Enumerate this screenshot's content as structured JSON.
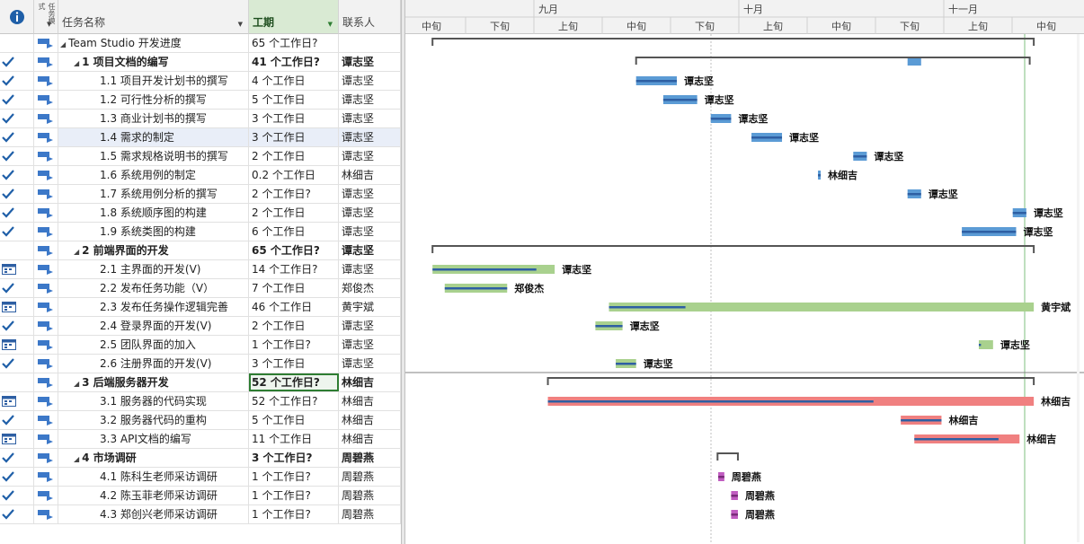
{
  "columns": {
    "info_icon": "info-icon",
    "mode_header": "任务模式",
    "name": "任务名称",
    "duration": "工期",
    "resource": "联系人"
  },
  "timescale": {
    "months": [
      {
        "label": "九月"
      },
      {
        "label": "十月"
      },
      {
        "label": "十一月"
      }
    ],
    "periods": [
      "中旬",
      "下旬",
      "上旬",
      "中旬",
      "下旬",
      "上旬",
      "中旬",
      "下旬",
      "上旬",
      "中旬"
    ]
  },
  "colors": {
    "blue_bar": "#5b9bd5",
    "blue_progress": "#2e5fa3",
    "green_bar": "#a9d18e",
    "red_bar": "#f08080",
    "purple_bar": "#c05cc0",
    "summary_bracket": "#555555",
    "check": "#1f5fa8",
    "selected_border": "#2e7d32"
  },
  "tasks": [
    {
      "ind": "",
      "name": "Team Studio 开发进度",
      "level": 0,
      "summary": true,
      "duration": "65 个工作日?",
      "resource": "",
      "bold": false,
      "bar": {
        "type": "summary",
        "start": 0.04,
        "end": 0.926
      }
    },
    {
      "ind": "check",
      "name": "1 项目文档的编写",
      "level": 1,
      "summary": true,
      "duration": "41 个工作日?",
      "resource": "谭志坚",
      "bold": true,
      "bar": {
        "type": "summary",
        "start": 0.34,
        "end": 0.92,
        "mark": {
          "start": 0.74,
          "end": 0.76
        }
      }
    },
    {
      "ind": "check",
      "name": "1.1 项目开发计划书的撰写",
      "level": 2,
      "duration": "4 个工作日",
      "resource": "谭志坚",
      "bar": {
        "color": "blue",
        "start": 0.34,
        "end": 0.4,
        "progress": 1,
        "label": "谭志坚"
      }
    },
    {
      "ind": "check",
      "name": "1.2 可行性分析的撰写",
      "level": 2,
      "duration": "5 个工作日",
      "resource": "谭志坚",
      "bar": {
        "color": "blue",
        "start": 0.38,
        "end": 0.43,
        "progress": 1,
        "label": "谭志坚"
      }
    },
    {
      "ind": "check",
      "name": "1.3 商业计划书的撰写",
      "level": 2,
      "duration": "3 个工作日",
      "resource": "谭志坚",
      "bar": {
        "color": "blue",
        "start": 0.45,
        "end": 0.48,
        "progress": 1,
        "label": "谭志坚"
      }
    },
    {
      "ind": "check",
      "name": "1.4 需求的制定",
      "level": 2,
      "duration": "3 个工作日",
      "resource": "谭志坚",
      "selected": true,
      "bar": {
        "color": "blue",
        "start": 0.51,
        "end": 0.555,
        "progress": 1,
        "label": "谭志坚"
      }
    },
    {
      "ind": "check",
      "name": "1.5 需求规格说明书的撰写",
      "level": 2,
      "duration": "2 个工作日",
      "resource": "谭志坚",
      "bar": {
        "color": "blue",
        "start": 0.66,
        "end": 0.68,
        "progress": 1,
        "label": "谭志坚"
      }
    },
    {
      "ind": "check",
      "name": "1.6 系统用例的制定",
      "level": 2,
      "duration": "0.2 个工作日",
      "resource": "林细吉",
      "bar": {
        "color": "blue",
        "start": 0.608,
        "end": 0.612,
        "progress": 1,
        "label": "林细吉"
      }
    },
    {
      "ind": "check",
      "name": "1.7 系统用例分析的撰写",
      "level": 2,
      "duration": "2 个工作日?",
      "resource": "谭志坚",
      "bar": {
        "color": "blue",
        "start": 0.74,
        "end": 0.76,
        "progress": 1,
        "label": "谭志坚"
      }
    },
    {
      "ind": "check",
      "name": "1.8 系统顺序图的构建",
      "level": 2,
      "duration": "2 个工作日",
      "resource": "谭志坚",
      "bar": {
        "color": "blue",
        "start": 0.895,
        "end": 0.915,
        "progress": 1,
        "label": "谭志坚"
      }
    },
    {
      "ind": "check",
      "name": "1.9 系统类图的构建",
      "level": 2,
      "duration": "6 个工作日",
      "resource": "谭志坚",
      "bar": {
        "color": "blue",
        "start": 0.82,
        "end": 0.9,
        "progress": 1,
        "label": "谭志坚"
      }
    },
    {
      "ind": "",
      "name": "2 前端界面的开发",
      "level": 1,
      "summary": true,
      "duration": "65 个工作日?",
      "resource": "谭志坚",
      "bold": true,
      "bar": {
        "type": "summary",
        "start": 0.04,
        "end": 0.926
      }
    },
    {
      "ind": "cal",
      "name": "2.1 主界面的开发(V)",
      "level": 2,
      "duration": "14 个工作日?",
      "resource": "谭志坚",
      "bar": {
        "color": "green",
        "start": 0.04,
        "end": 0.22,
        "progress": 0.85,
        "label": "谭志坚"
      }
    },
    {
      "ind": "check",
      "name": "2.2 发布任务功能（V）",
      "level": 2,
      "duration": "7 个工作日",
      "resource": "郑俊杰",
      "bar": {
        "color": "green",
        "start": 0.058,
        "end": 0.15,
        "progress": 1,
        "label": "郑俊杰"
      }
    },
    {
      "ind": "cal",
      "name": "2.3 发布任务操作逻辑完善",
      "level": 2,
      "duration": "46 个工作日",
      "resource": "黄宇斌",
      "bar": {
        "color": "green",
        "start": 0.3,
        "end": 0.926,
        "progress": 0.18,
        "label": "黄宇斌"
      }
    },
    {
      "ind": "check",
      "name": "2.4 登录界面的开发(V)",
      "level": 2,
      "duration": "2 个工作日",
      "resource": "谭志坚",
      "bar": {
        "color": "green",
        "start": 0.28,
        "end": 0.32,
        "progress": 1,
        "label": "谭志坚"
      }
    },
    {
      "ind": "cal",
      "name": "2.5 团队界面的加入",
      "level": 2,
      "duration": "1 个工作日?",
      "resource": "谭志坚",
      "bar": {
        "color": "green",
        "start": 0.845,
        "end": 0.866,
        "progress": 0.15,
        "label": "谭志坚"
      }
    },
    {
      "ind": "check",
      "name": "2.6 注册界面的开发(V)",
      "level": 2,
      "duration": "3 个工作日",
      "resource": "谭志坚",
      "bar": {
        "color": "green",
        "start": 0.31,
        "end": 0.34,
        "progress": 1,
        "label": "谭志坚"
      }
    },
    {
      "ind": "",
      "name": "3 后端服务器开发",
      "level": 1,
      "summary": true,
      "duration": "52 个工作日?",
      "resource": "林细吉",
      "bold": true,
      "selected_dur": true,
      "bar": {
        "type": "summary",
        "start": 0.21,
        "end": 0.926
      }
    },
    {
      "ind": "cal",
      "name": "3.1 服务器的代码实现",
      "level": 2,
      "duration": "52 个工作日?",
      "resource": "林细吉",
      "bar": {
        "color": "red",
        "start": 0.21,
        "end": 0.926,
        "progress": 0.67,
        "label": "林细吉"
      }
    },
    {
      "ind": "check",
      "name": "3.2 服务器代码的重构",
      "level": 2,
      "duration": "5 个工作日",
      "resource": "林细吉",
      "bar": {
        "color": "red",
        "start": 0.73,
        "end": 0.79,
        "progress": 1,
        "label": "林细吉"
      }
    },
    {
      "ind": "cal",
      "name": "3.3 API文档的编写",
      "level": 2,
      "duration": "11 个工作日",
      "resource": "林细吉",
      "bar": {
        "color": "red",
        "start": 0.75,
        "end": 0.905,
        "progress": 0.8,
        "label": "林细吉"
      }
    },
    {
      "ind": "check",
      "name": "4 市场调研",
      "level": 1,
      "summary": true,
      "duration": "3 个工作日?",
      "resource": "周碧燕",
      "bold": true,
      "bar": {
        "type": "summary",
        "start": 0.46,
        "end": 0.49
      }
    },
    {
      "ind": "check",
      "name": "4.1 陈科生老师采访调研",
      "level": 2,
      "duration": "1 个工作日?",
      "resource": "周碧燕",
      "bar": {
        "color": "purple",
        "start": 0.461,
        "end": 0.47,
        "progress": 1,
        "label": "周碧燕"
      }
    },
    {
      "ind": "check",
      "name": "4.2 陈玉菲老师采访调研",
      "level": 2,
      "duration": "1 个工作日?",
      "resource": "周碧燕",
      "bar": {
        "color": "purple",
        "start": 0.48,
        "end": 0.49,
        "progress": 1,
        "label": "周碧燕"
      }
    },
    {
      "ind": "check",
      "name": "4.3 郑创兴老师采访调研",
      "level": 2,
      "duration": "1 个工作日?",
      "resource": "周碧燕",
      "bar": {
        "color": "purple",
        "start": 0.48,
        "end": 0.49,
        "progress": 1,
        "label": "周碧燕"
      }
    }
  ]
}
